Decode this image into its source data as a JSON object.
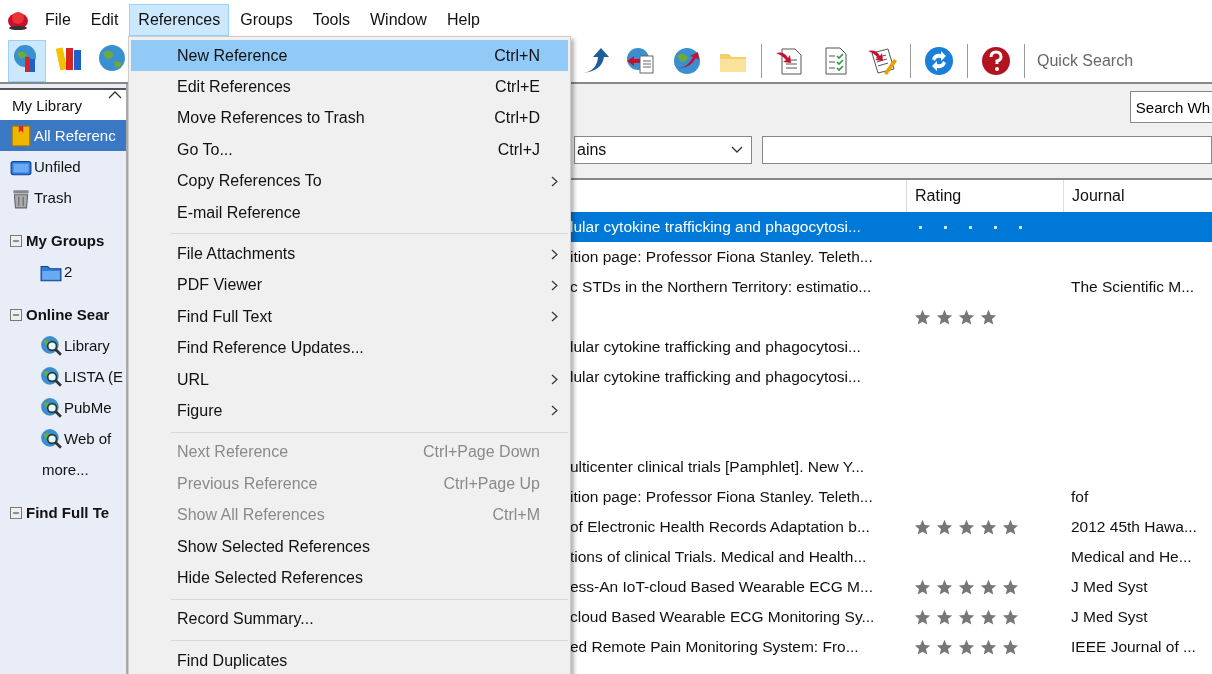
{
  "menubar": [
    {
      "label": "File",
      "selected": false
    },
    {
      "label": "Edit",
      "selected": false
    },
    {
      "label": "References",
      "selected": true
    },
    {
      "label": "Groups",
      "selected": false
    },
    {
      "label": "Tools",
      "selected": false
    },
    {
      "label": "Window",
      "selected": false
    },
    {
      "label": "Help",
      "selected": false
    }
  ],
  "toolbar": {
    "left_tools": [
      {
        "kind": "globe-books",
        "selected": true
      },
      {
        "kind": "books",
        "selected": false
      },
      {
        "kind": "globe",
        "selected": false
      }
    ],
    "right_tools": [
      {
        "kind": "arrow"
      },
      {
        "kind": "globe-doc"
      },
      {
        "kind": "globe-arrow"
      },
      {
        "kind": "folder"
      },
      {
        "kind": "sep"
      },
      {
        "kind": "doc-arrow"
      },
      {
        "kind": "checklist"
      },
      {
        "kind": "pen-doc"
      },
      {
        "kind": "sep"
      },
      {
        "kind": "sync"
      },
      {
        "kind": "sep"
      },
      {
        "kind": "help"
      },
      {
        "kind": "sep"
      }
    ],
    "quick_search": {
      "placeholder": "Quick Search"
    }
  },
  "sidebar": {
    "title": "My Library",
    "items": [
      {
        "kind": "all",
        "label": "All Referenc",
        "selected": true
      },
      {
        "kind": "unfiled",
        "label": "Unfiled",
        "selected": false
      },
      {
        "kind": "trash",
        "label": "Trash",
        "selected": false
      },
      {
        "kind": "group",
        "label": "My Groups",
        "expanded": true,
        "children": [
          {
            "kind": "folder",
            "label": "2",
            "selected": false
          }
        ]
      },
      {
        "kind": "group",
        "label": "Online Sear",
        "expanded": true,
        "children": [
          {
            "kind": "online",
            "label": "Library",
            "selected": false
          },
          {
            "kind": "online",
            "label": "LISTA (E",
            "selected": false
          },
          {
            "kind": "online",
            "label": "PubMe",
            "selected": false
          },
          {
            "kind": "online",
            "label": "Web of",
            "selected": false
          },
          {
            "kind": "more",
            "label": "more...",
            "selected": false
          }
        ]
      },
      {
        "kind": "group",
        "label": "Find Full Te",
        "expanded": true
      }
    ]
  },
  "search_panel": {
    "search_button": "Search Wh",
    "field_dropdown": "ains"
  },
  "table": {
    "columns": [
      "Rating",
      "Journal"
    ],
    "rows": [
      {
        "title": "lular cytokine trafficking and phagocytosi...",
        "selected": true
      },
      {
        "title": "ition page: Professor Fiona Stanley. Teleth...",
        "selected": false
      },
      {
        "title": "c STDs in the Northern Territory: estimatio...",
        "journal": "The Scientific M...",
        "selected": false
      },
      {
        "stars": 4,
        "selected": false
      },
      {
        "title": "lular cytokine trafficking and phagocytosi...",
        "selected": false
      },
      {
        "title": "lular cytokine trafficking and phagocytosi...",
        "selected": false
      },
      {
        "selected": false
      },
      {
        "selected": false
      },
      {
        "title": "ulticenter clinical trials [Pamphlet]. New Y...",
        "selected": false
      },
      {
        "title": "ition page: Professor Fiona Stanley. Teleth...",
        "journal": "fof",
        "selected": false
      },
      {
        "title": "of Electronic Health Records Adaptation b...",
        "stars": 5,
        "journal": "2012 45th Hawa...",
        "selected": false
      },
      {
        "title": "tions of clinical Trials. Medical and Health...",
        "journal": "Medical and He...",
        "selected": false
      },
      {
        "title": "ess-An IoT-cloud Based Wearable ECG M...",
        "stars": 5,
        "journal": "J Med Syst",
        "selected": false
      },
      {
        "title": "cloud Based Wearable ECG Monitoring Sy...",
        "stars": 5,
        "journal": "J Med Syst",
        "selected": false
      },
      {
        "title": "ed Remote Pain Monitoring System: Fro...",
        "stars": 5,
        "journal": "IEEE Journal of ...",
        "selected": false
      }
    ]
  },
  "references_menu": [
    {
      "kind": "item",
      "label": "New Reference",
      "shortcut": "Ctrl+N",
      "disabled": false,
      "selected": true
    },
    {
      "kind": "item",
      "label": "Edit References",
      "shortcut": "Ctrl+E",
      "disabled": false,
      "selected": false
    },
    {
      "kind": "item",
      "label": "Move References to Trash",
      "shortcut": "Ctrl+D",
      "disabled": false,
      "selected": false
    },
    {
      "kind": "item",
      "label": "Go To...",
      "shortcut": "Ctrl+J",
      "disabled": false,
      "selected": false
    },
    {
      "kind": "item",
      "label": "Copy References To",
      "submenu": true,
      "disabled": false,
      "selected": false
    },
    {
      "kind": "item",
      "label": "E-mail Reference",
      "disabled": false,
      "selected": false
    },
    {
      "kind": "separator"
    },
    {
      "kind": "item",
      "label": "File Attachments",
      "submenu": true,
      "disabled": false,
      "selected": false
    },
    {
      "kind": "item",
      "label": "PDF Viewer",
      "submenu": true,
      "disabled": false,
      "selected": false
    },
    {
      "kind": "item",
      "label": "Find Full Text",
      "submenu": true,
      "disabled": false,
      "selected": false
    },
    {
      "kind": "item",
      "label": "Find Reference Updates...",
      "disabled": false,
      "selected": false
    },
    {
      "kind": "item",
      "label": "URL",
      "submenu": true,
      "disabled": false,
      "selected": false
    },
    {
      "kind": "item",
      "label": "Figure",
      "submenu": true,
      "disabled": false,
      "selected": false
    },
    {
      "kind": "separator"
    },
    {
      "kind": "item",
      "label": "Next Reference",
      "shortcut": "Ctrl+Page Down",
      "disabled": true,
      "selected": false
    },
    {
      "kind": "item",
      "label": "Previous Reference",
      "shortcut": "Ctrl+Page Up",
      "disabled": true,
      "selected": false
    },
    {
      "kind": "item",
      "label": "Show All References",
      "shortcut": "Ctrl+M",
      "disabled": true,
      "selected": false
    },
    {
      "kind": "item",
      "label": "Show Selected References",
      "disabled": false,
      "selected": false
    },
    {
      "kind": "item",
      "label": "Hide Selected References",
      "disabled": false,
      "selected": false
    },
    {
      "kind": "separator"
    },
    {
      "kind": "item",
      "label": "Record Summary...",
      "disabled": false,
      "selected": false
    },
    {
      "kind": "separator"
    },
    {
      "kind": "item",
      "label": "Find Duplicates",
      "disabled": false,
      "selected": false
    }
  ]
}
